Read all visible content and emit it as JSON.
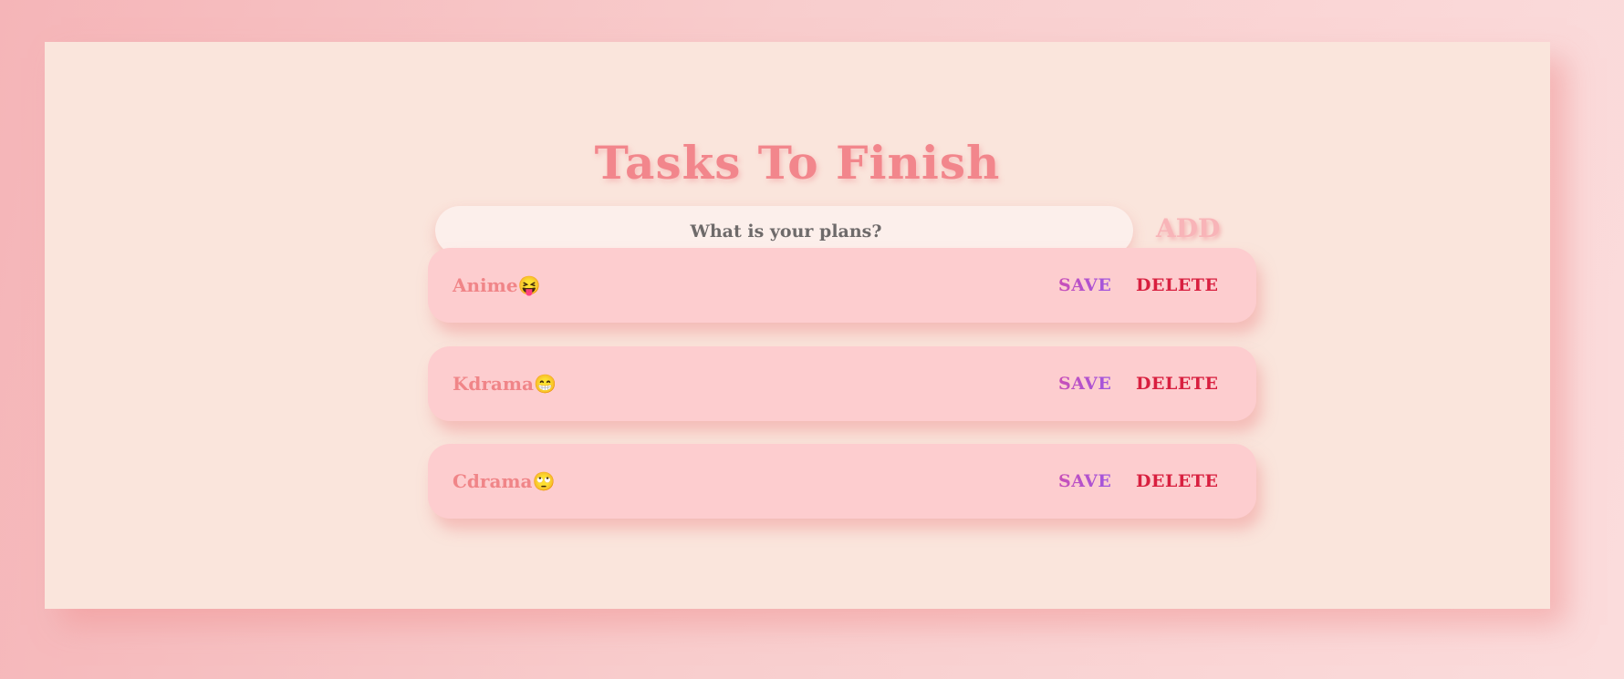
{
  "header": {
    "title": "Tasks To Finish"
  },
  "input": {
    "placeholder": "What is your plans?",
    "value": ""
  },
  "add_button": {
    "label": "ADD"
  },
  "tasks": [
    {
      "label": "Anime",
      "emoji": "😝",
      "save_label": "SAVE",
      "delete_label": "DELETE"
    },
    {
      "label": "Kdrama",
      "emoji": "😁",
      "save_label": "SAVE",
      "delete_label": "DELETE"
    },
    {
      "label": "Cdrama",
      "emoji": "🙄",
      "save_label": "SAVE",
      "delete_label": "DELETE"
    }
  ],
  "colors": {
    "background": "#f8cdcd",
    "card": "#fae5dc",
    "title": "#f2868c",
    "task_bg": "#fdcdcf",
    "task_text": "#f08588",
    "save": "#b250cc",
    "delete": "#d81f3f",
    "add": "#f8b4b8"
  }
}
